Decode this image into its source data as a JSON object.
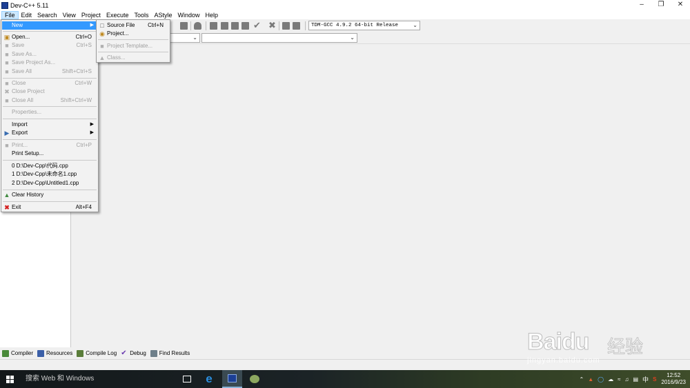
{
  "window": {
    "title": "Dev-C++ 5.11"
  },
  "menubar": {
    "items": [
      {
        "label": "File",
        "active": true
      },
      {
        "label": "Edit"
      },
      {
        "label": "Search"
      },
      {
        "label": "View"
      },
      {
        "label": "Project"
      },
      {
        "label": "Execute"
      },
      {
        "label": "Tools"
      },
      {
        "label": "AStyle"
      },
      {
        "label": "Window"
      },
      {
        "label": "Help"
      }
    ]
  },
  "toolbar": {
    "compiler_select": "TDM-GCC 4.9.2 64-bit Release"
  },
  "file_menu": {
    "new": "New",
    "open": "Open...",
    "open_sc": "Ctrl+O",
    "save": "Save",
    "save_sc": "Ctrl+S",
    "save_as": "Save As...",
    "save_project_as": "Save Project As...",
    "save_all": "Save All",
    "save_all_sc": "Shift+Ctrl+S",
    "close": "Close",
    "close_sc": "Ctrl+W",
    "close_project": "Close Project",
    "close_all": "Close All",
    "close_all_sc": "Shift+Ctrl+W",
    "properties": "Properties...",
    "import": "Import",
    "export": "Export",
    "print": "Print...",
    "print_sc": "Ctrl+P",
    "print_setup": "Print Setup...",
    "recent": [
      "0 D:\\Dev-Cpp\\代码.cpp",
      "1 D:\\Dev-Cpp\\未命名1.cpp",
      "2 D:\\Dev-Cpp\\Untitled1.cpp"
    ],
    "clear_history": "Clear History",
    "exit": "Exit",
    "exit_sc": "Alt+F4"
  },
  "new_submenu": {
    "source_file": "Source File",
    "source_file_sc": "Ctrl+N",
    "project": "Project...",
    "project_template": "Project Template...",
    "class": "Class..."
  },
  "bottom_tabs": [
    "Compiler",
    "Resources",
    "Compile Log",
    "Debug",
    "Find Results"
  ],
  "taskbar": {
    "search_placeholder": "搜索 Web 和 Windows",
    "time": "12:52",
    "date": "2016/9/23",
    "ime": "中"
  },
  "watermark": {
    "logo": "Baidu",
    "cn": "经验",
    "sub": "jingyan.baidu.com"
  },
  "colors": {
    "highlight": "#3399ff",
    "menubar_active": "#cce8ff",
    "app_icon": "#1c3f95"
  }
}
